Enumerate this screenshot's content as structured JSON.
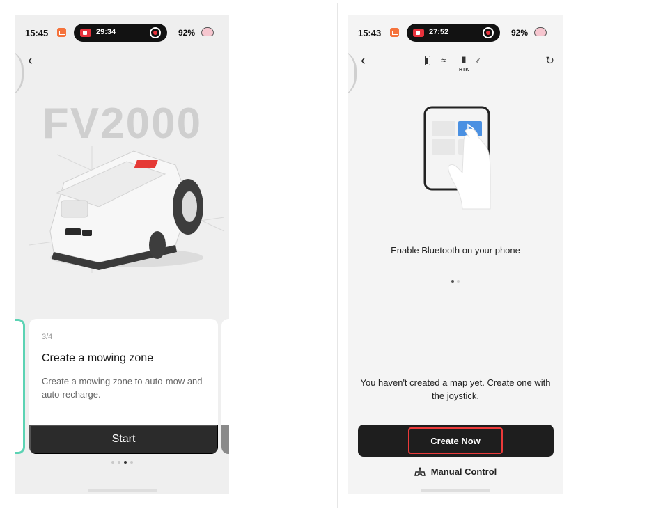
{
  "left_phone": {
    "status": {
      "time": "15:45",
      "timer": "29:34",
      "battery": "92%"
    },
    "model": "FV2000",
    "card": {
      "step": "3/4",
      "title": "Create a mowing zone",
      "description": "Create a mowing zone to auto-mow and auto-recharge.",
      "button": "Start"
    },
    "pagination": {
      "total": 4,
      "active": 3
    }
  },
  "right_phone": {
    "status": {
      "time": "15:43",
      "timer": "27:52",
      "battery": "92%"
    },
    "toolbar_icons": [
      "battery-icon",
      "wifi-icon",
      "rtk-icon",
      "signal-icon"
    ],
    "rtk_label": "RTK",
    "enable_text": "Enable Bluetooth on your phone",
    "pagination": {
      "total": 2,
      "active": 1
    },
    "map_message": "You haven't created a map yet. Create one with the joystick.",
    "create_button": "Create Now",
    "manual_control": "Manual Control"
  },
  "colors": {
    "accent_teal": "#5cd3b4",
    "highlight_red": "#ec3a3a",
    "dark_button": "#2b2b2b",
    "bluetooth_blue": "#4a90e2"
  }
}
